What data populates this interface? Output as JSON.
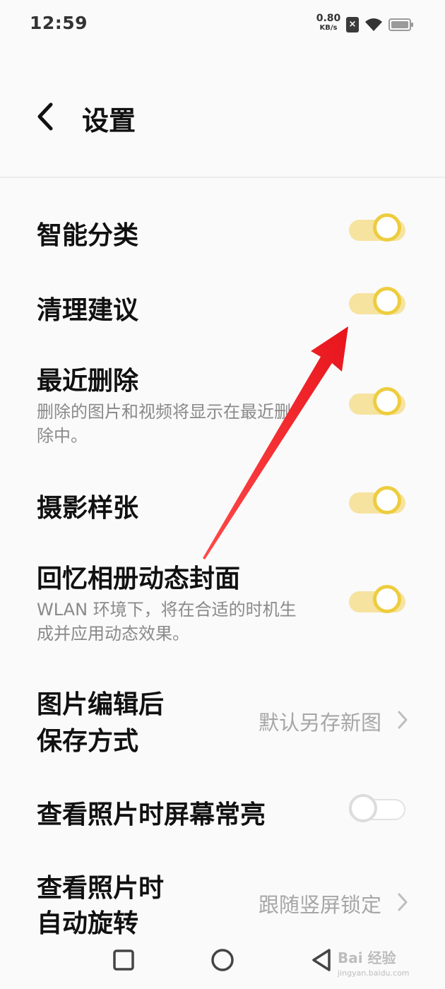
{
  "status_bar": {
    "time": "12:59",
    "net_speed_value": "0.80",
    "net_speed_unit": "KB/s",
    "sim_icon": "sim-off-icon",
    "wifi_icon": "wifi-icon",
    "battery_icon": "battery-icon"
  },
  "header": {
    "back_icon": "chevron-left-icon",
    "title": "设置"
  },
  "settings": [
    {
      "title": "智能分类",
      "toggle": true
    },
    {
      "title": "清理建议",
      "toggle": true
    },
    {
      "title": "最近删除",
      "description": "删除的图片和视频将显示在最近删除中。",
      "toggle": true
    },
    {
      "title": "摄影样张",
      "toggle": true
    },
    {
      "title": "回忆相册动态封面",
      "description": "WLAN 环境下，将在合适的时机生成并应用动态效果。",
      "toggle": true
    },
    {
      "title_line1": "图片编辑后",
      "title_line2": "保存方式",
      "value": "默认另存新图"
    },
    {
      "title": "查看照片时屏幕常亮",
      "toggle": false
    },
    {
      "title_line1": "查看照片时",
      "title_line2": "自动旋转",
      "value": "跟随竖屏锁定"
    }
  ],
  "colors": {
    "accent": "#edcd3f",
    "accent_track": "#f6e3a0",
    "annotation_arrow": "#e8141c"
  },
  "nav_bar": {
    "recent_icon": "square-icon",
    "home_icon": "circle-icon",
    "back_icon": "triangle-back-icon"
  },
  "watermark": {
    "text": "Bai 经验",
    "url": "jingyan.baidu.com"
  }
}
